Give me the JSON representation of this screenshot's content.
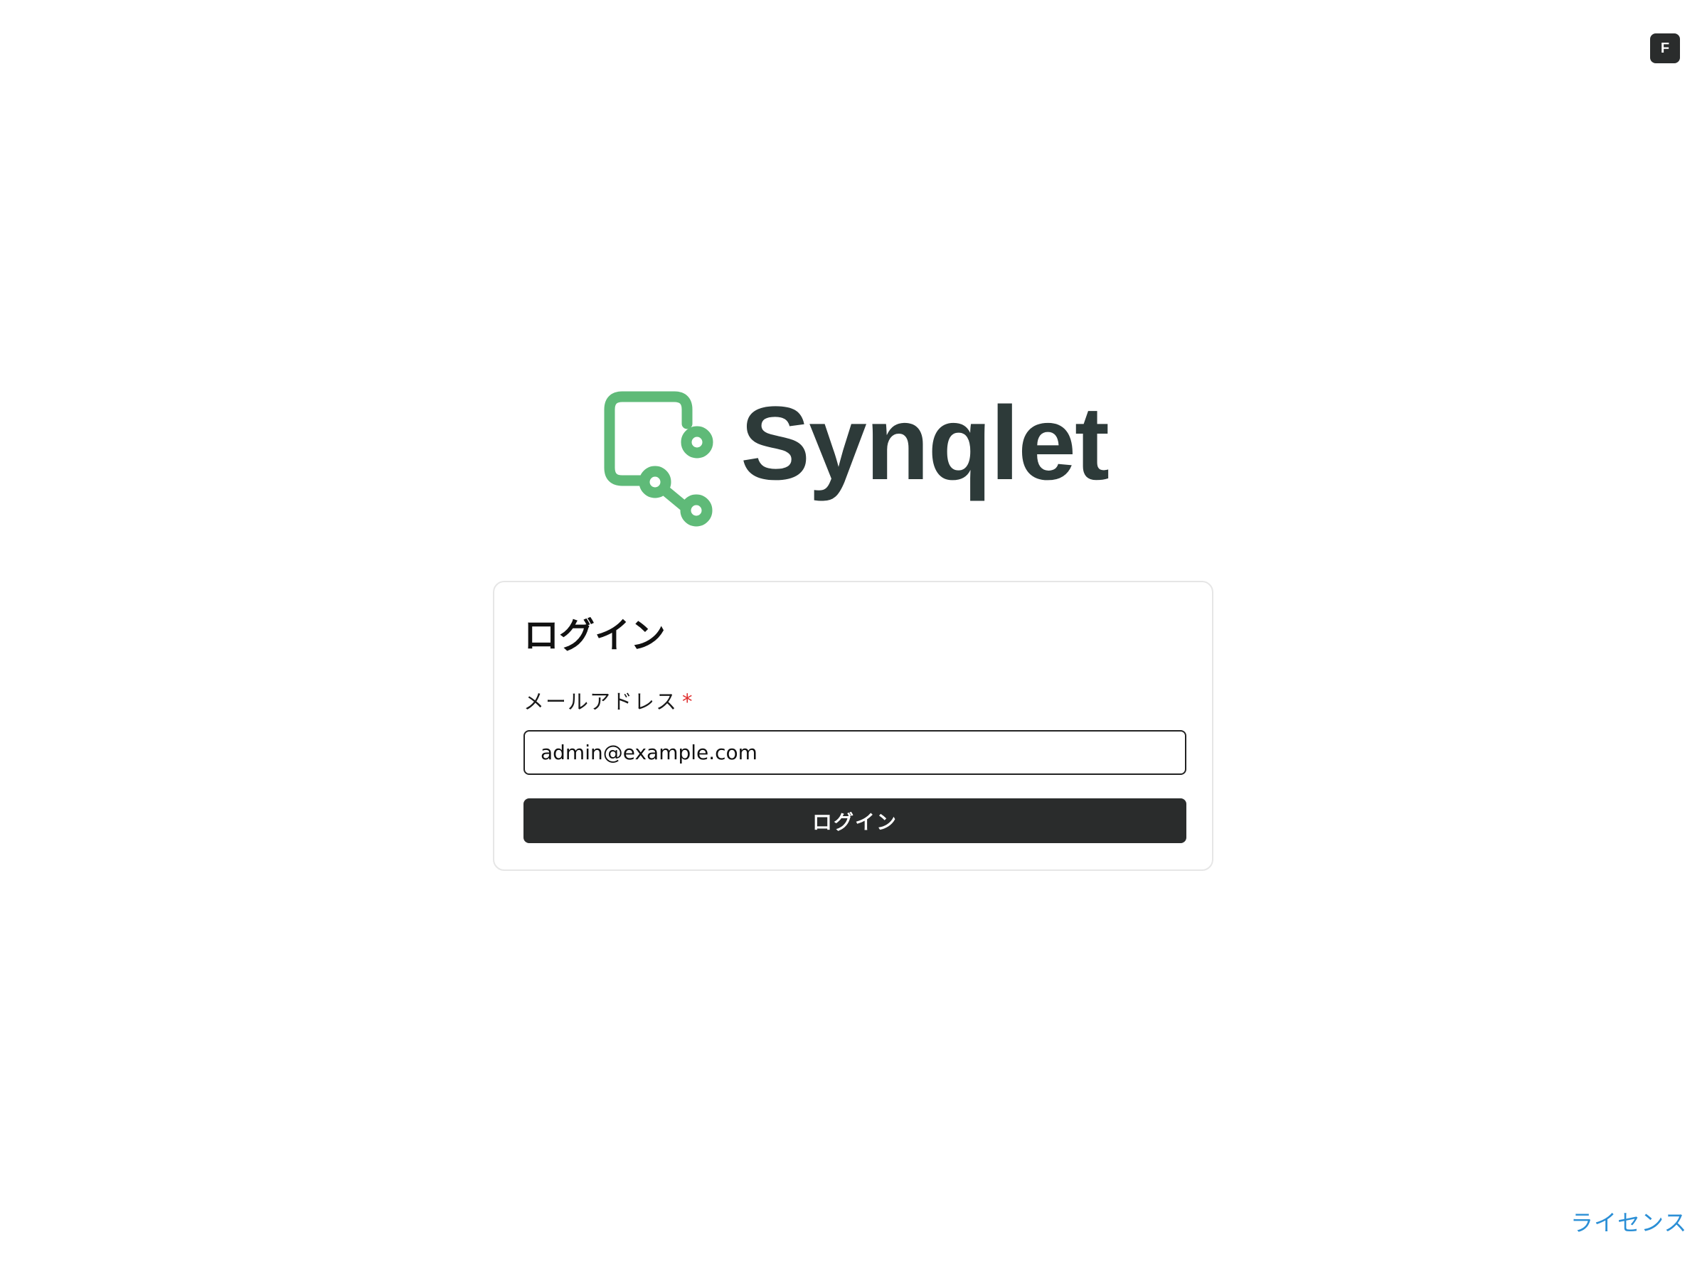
{
  "top_badge": {
    "label": "F"
  },
  "logo": {
    "wordmark": "Synqlet",
    "icon": "synqlet-logo-icon",
    "colors": {
      "icon": "#5fba78",
      "wordmark": "#2d3a39"
    }
  },
  "login_card": {
    "title": "ログイン",
    "email_field": {
      "label": "メールアドレス",
      "required_mark": "*",
      "value": "admin@example.com",
      "type": "email"
    },
    "submit_button": {
      "label": "ログイン"
    }
  },
  "footer": {
    "license_link": "ライセンス"
  },
  "colors": {
    "button_bg": "#2a2c2c",
    "button_text": "#ffffff",
    "link": "#2b8fd6",
    "required": "#e03131",
    "card_border": "#e6e6e6"
  }
}
